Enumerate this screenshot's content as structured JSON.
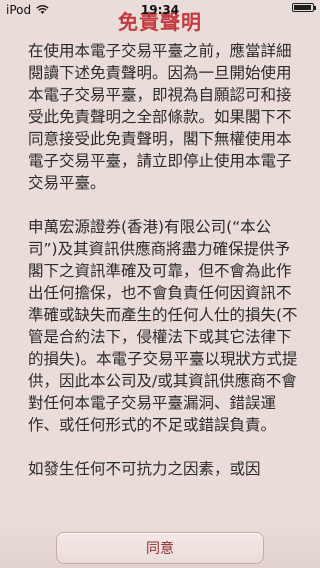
{
  "status_bar": {
    "carrier": "iPod",
    "time": "19:34",
    "battery_level": 0.95
  },
  "header": {
    "title": "免責聲明"
  },
  "content": {
    "paragraphs": [
      "在使用本電子交易平臺之前，應當詳細閱讀下述免責聲明。因為一旦開始使用本電子交易平臺，即視為自願認可和接受此免責聲明之全部條款。如果閣下不同意接受此免責聲明，閣下無權使用本電子交易平臺，請立即停止使用本電子交易平臺。",
      "申萬宏源證券(香港)有限公司(“本公司”)及其資訊供應商將盡力確保提供予閣下之資訊準確及可靠，但不會為此作出任何擔保，也不會負責任何因資訊不準確或缺失而產生的任何人仕的損失(不管是合約法下，侵權法下或其它法律下的損失)。本電子交易平臺以現狀方式提供，因此本公司及/或其資訊供應商不會對任何本電子交易平臺漏洞、錯誤運作、或任何形式的不足或錯誤負責。",
      "如發生任何不可抗力之因素，或因"
    ]
  },
  "footer": {
    "agree_label": "同意"
  }
}
